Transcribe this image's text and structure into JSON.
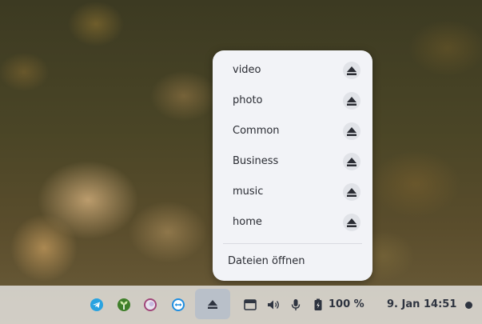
{
  "drives_menu": {
    "items": [
      {
        "label": "video",
        "eject_icon": "eject-icon"
      },
      {
        "label": "photo",
        "eject_icon": "eject-icon"
      },
      {
        "label": "Common",
        "eject_icon": "eject-icon"
      },
      {
        "label": "Business",
        "eject_icon": "eject-icon"
      },
      {
        "label": "music",
        "eject_icon": "eject-icon"
      },
      {
        "label": "home",
        "eject_icon": "eject-icon"
      }
    ],
    "open_files_label": "Dateien öffnen"
  },
  "taskbar": {
    "tray_apps": [
      "telegram-icon",
      "seedling-icon",
      "color-disc-icon",
      "remote-desktop-icon"
    ],
    "drives_button_icon": "eject-icon",
    "system_icons": [
      "keyboard-icon",
      "volume-icon",
      "microphone-icon",
      "battery-icon"
    ],
    "battery_level": "100 %",
    "date": "9. Jan",
    "time": "14:51",
    "notification_icon": "notification-dot-icon"
  },
  "colors": {
    "menu_background": "#f2f3f7",
    "eject_button": "#e1e3e8",
    "active_tray_button": "#b9c0c9",
    "accent_blue": "#2aa3e0",
    "text": "#2a2c33"
  }
}
